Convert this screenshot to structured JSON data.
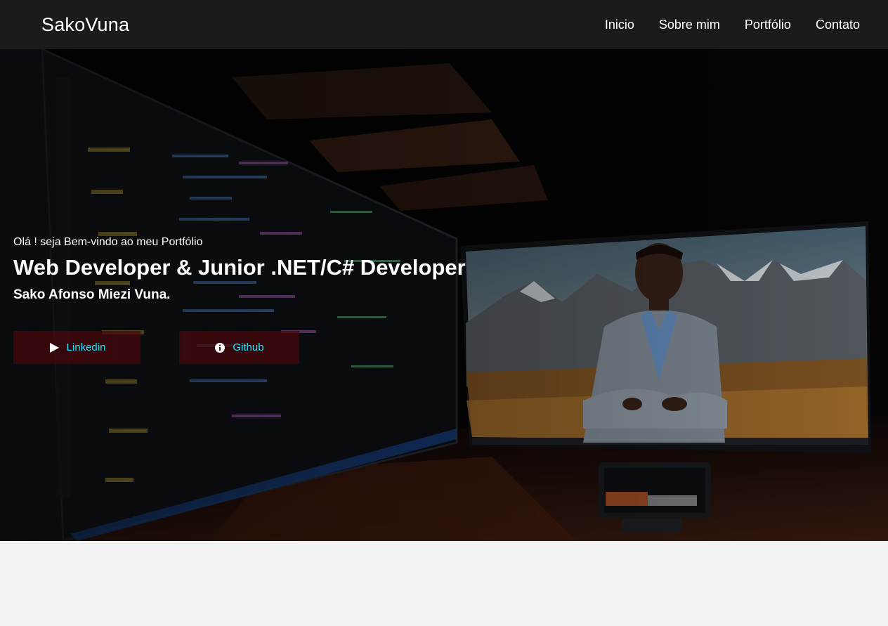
{
  "nav": {
    "brand": "SakoVuna",
    "links": [
      "Inicio",
      "Sobre mim",
      "Portfólio",
      "Contato"
    ]
  },
  "hero": {
    "greeting": "Olá ! seja Bem-vindo ao meu Portfólio",
    "headline": "Web Developer & Junior .NET/C# Developer",
    "name": "Sako Afonso Miezi Vuna.",
    "buttons": {
      "linkedin": {
        "label": "Linkedin",
        "icon": "play-icon"
      },
      "github": {
        "label": "Github",
        "icon": "info-icon"
      }
    }
  },
  "colors": {
    "navbar_bg": "#1b1b1b",
    "button_text": "#19e8ff",
    "button_bg": "#46080c",
    "page_bg": "#f2f2f2"
  }
}
